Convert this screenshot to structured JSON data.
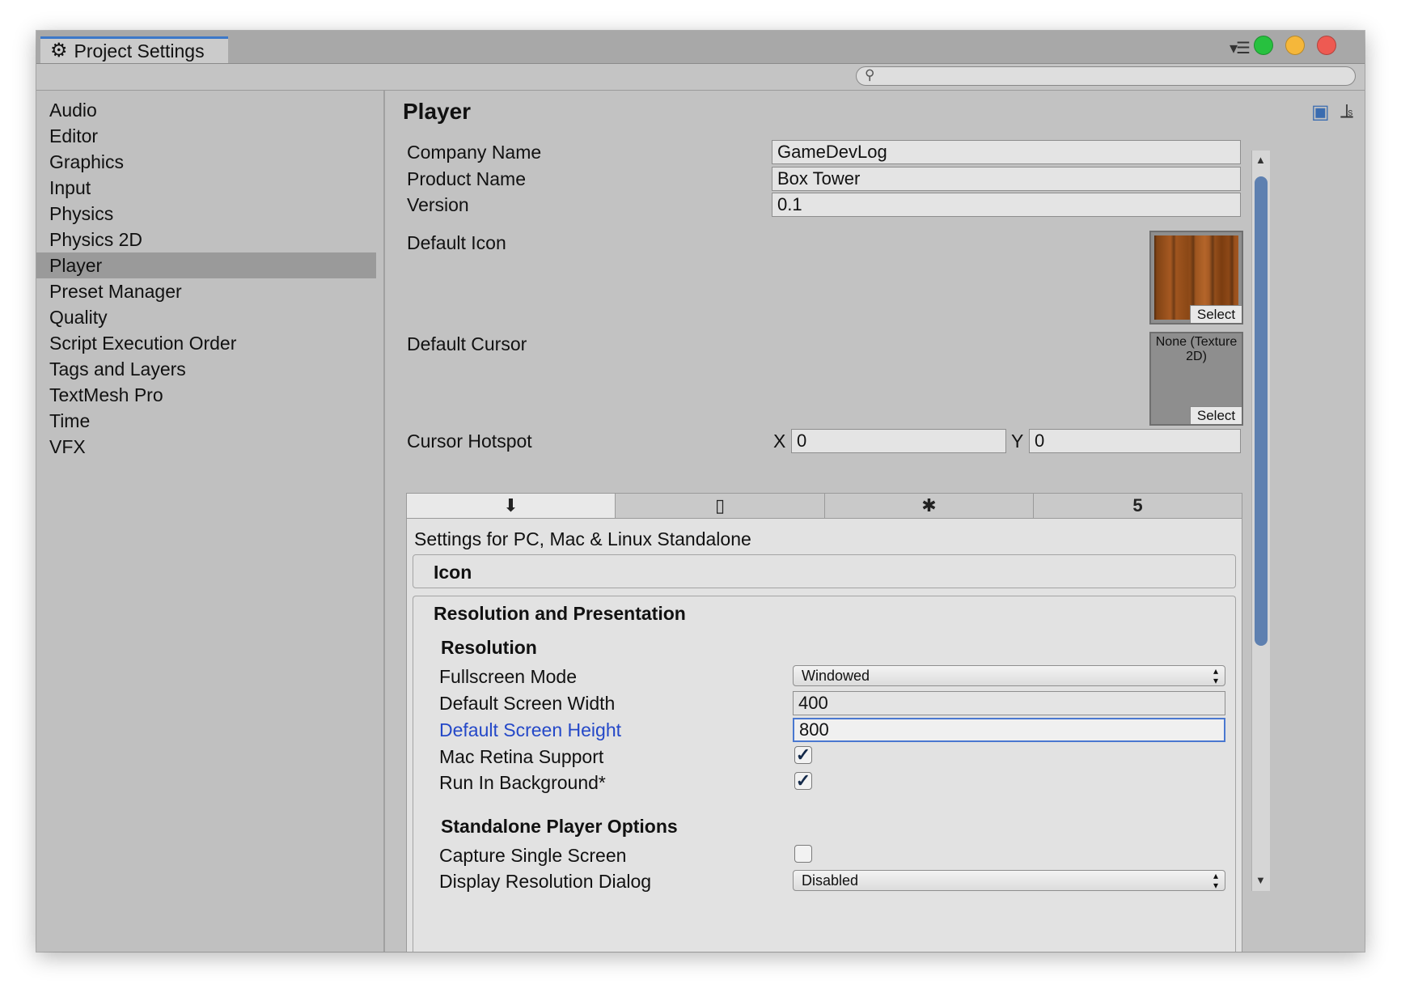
{
  "window": {
    "tab_title": "Project Settings",
    "search_placeholder": ""
  },
  "sidebar": {
    "items": [
      {
        "label": "Audio"
      },
      {
        "label": "Editor"
      },
      {
        "label": "Graphics"
      },
      {
        "label": "Input"
      },
      {
        "label": "Physics"
      },
      {
        "label": "Physics 2D"
      },
      {
        "label": "Player",
        "selected": true
      },
      {
        "label": "Preset Manager"
      },
      {
        "label": "Quality"
      },
      {
        "label": "Script Execution Order"
      },
      {
        "label": "Tags and Layers"
      },
      {
        "label": "TextMesh Pro"
      },
      {
        "label": "Time"
      },
      {
        "label": "VFX"
      }
    ]
  },
  "player": {
    "title": "Player",
    "company_name_label": "Company Name",
    "company_name": "GameDevLog",
    "product_name_label": "Product Name",
    "product_name": "Box Tower",
    "version_label": "Version",
    "version": "0.1",
    "default_icon_label": "Default Icon",
    "default_cursor_label": "Default Cursor",
    "cursor_none_text": "None (Texture 2D)",
    "select_label": "Select",
    "cursor_hotspot_label": "Cursor Hotspot",
    "hotspot_x_label": "X",
    "hotspot_x": "0",
    "hotspot_y_label": "Y",
    "hotspot_y": "0"
  },
  "platform": {
    "settings_for": "Settings for PC, Mac & Linux Standalone",
    "icon_section": "Icon",
    "res_section": "Resolution and Presentation",
    "resolution_header": "Resolution",
    "fullscreen_mode_label": "Fullscreen Mode",
    "fullscreen_mode": "Windowed",
    "screen_width_label": "Default Screen Width",
    "screen_width": "400",
    "screen_height_label": "Default Screen Height",
    "screen_height": "800",
    "retina_label": "Mac Retina Support",
    "retina_checked": true,
    "run_bg_label": "Run In Background*",
    "run_bg_checked": true,
    "standalone_header": "Standalone Player Options",
    "capture_label": "Capture Single Screen",
    "capture_checked": false,
    "res_dialog_label": "Display Resolution Dialog",
    "res_dialog": "Disabled"
  },
  "colors": {
    "accent": "#3c78c8",
    "focused_label": "#2448c8",
    "close": "#ee5a52",
    "minimize": "#f5b73a",
    "zoom": "#27c13f"
  }
}
